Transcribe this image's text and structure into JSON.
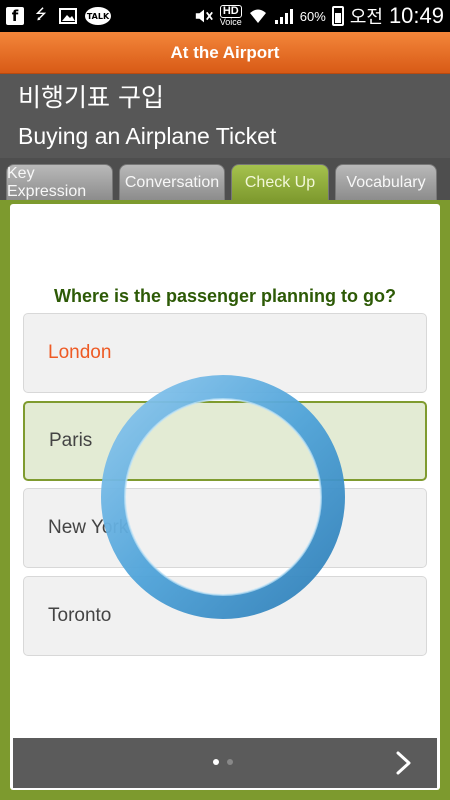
{
  "statusbar": {
    "icons": [
      "facebook-icon",
      "usb-icon",
      "image-icon",
      "kakaotalk-icon",
      "mute-icon",
      "hd-voice-icon",
      "wifi-icon",
      "signal-icon"
    ],
    "talk_label": "TALK",
    "hd_label": "HD",
    "voice_label": "Voice",
    "battery_percent": "60%",
    "ampm": "오전",
    "time": "10:49"
  },
  "titlebar": {
    "title": "At the Airport"
  },
  "header": {
    "title_ko": "비행기표 구입",
    "title_en": "Buying an Airplane Ticket"
  },
  "tabs": [
    {
      "label": "Key Expression",
      "active": false
    },
    {
      "label": "Conversation",
      "active": false
    },
    {
      "label": "Check Up",
      "active": true
    },
    {
      "label": "Vocabulary",
      "active": false
    }
  ],
  "quiz": {
    "question": "Where is the passenger planning to go?",
    "options": [
      "London",
      "Paris",
      "New York",
      "Toronto"
    ],
    "selected_index": 1,
    "highlighted_red_index": 0
  },
  "pager": {
    "page_count": 2,
    "current_page": 1
  },
  "colors": {
    "title_orange": "#e8701f",
    "header_gray": "#575757",
    "accent_green": "#7f9b2f",
    "question_green": "#2d5a06",
    "option_red": "#ee5a24",
    "ring_blue": "#4fa3d9"
  }
}
